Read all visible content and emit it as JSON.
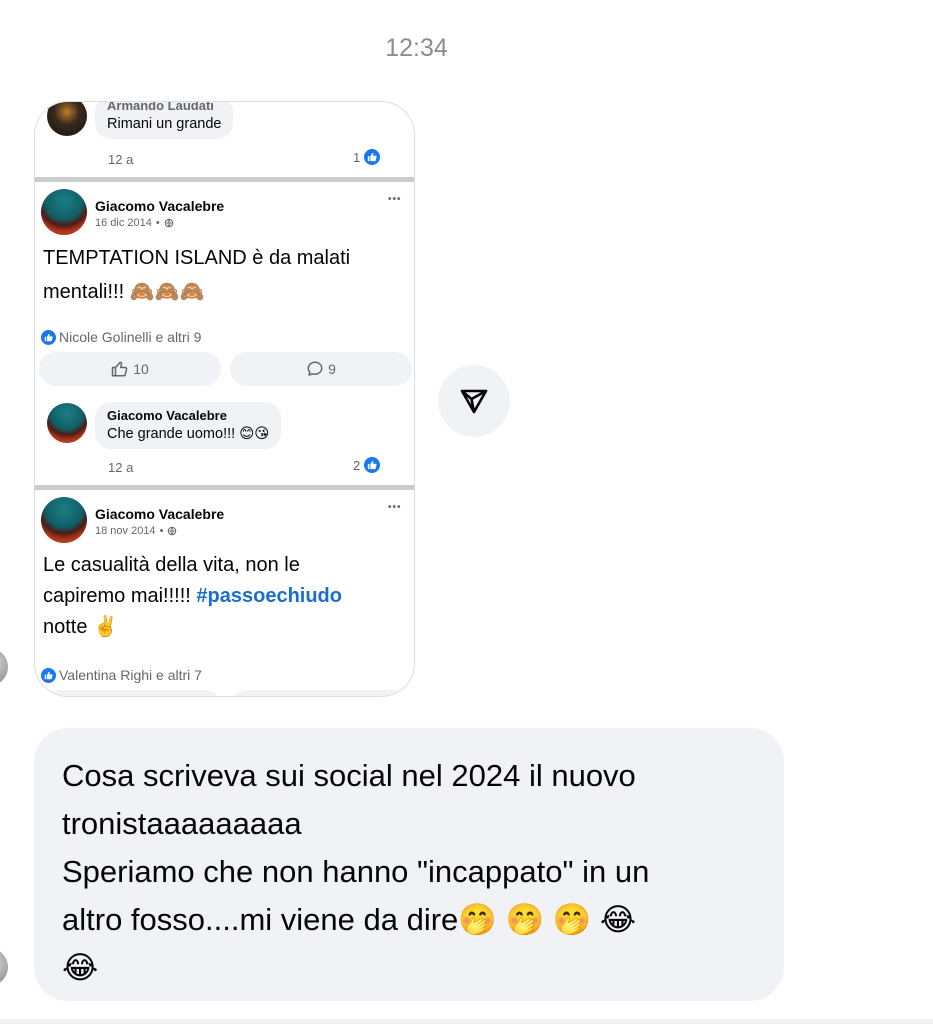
{
  "time": "12:34",
  "shared_post": {
    "first_comment": {
      "author": "Armando Laudati",
      "text": "Rimani un grande",
      "age": "12 a",
      "likes": "1"
    },
    "posts": [
      {
        "author": "Giacomo Vacalebre",
        "date": "16 dic 2014",
        "separator": "•",
        "more": "•••",
        "text_lines": [
          "TEMPTATION ISLAND è da malati",
          "mentali!!! 🙈🙈🙈"
        ],
        "reactions": "Nicole Golinelli e altri 9",
        "like_count": "10",
        "comment_count": "9",
        "comment": {
          "author": "Giacomo Vacalebre",
          "text": "Che grande uomo!!! 😊😘",
          "age": "12 a",
          "likes": "2"
        }
      },
      {
        "author": "Giacomo Vacalebre",
        "date": "18 nov 2014",
        "separator": "•",
        "more": "•••",
        "text_line1": "Le casualità della vita, non le",
        "text_line2_plain": "capiremo mai!!!!! ",
        "hashtag": "#passoechiudo",
        "text_line3": "notte ✌️",
        "reactions": "Valentina Righi e altri 7"
      }
    ]
  },
  "message": {
    "lines": [
      "Cosa scriveva sui social nel 2024 il nuovo",
      "tronistaaaaaaaaa",
      "Speriamo che non hanno \"incappato\" in un",
      "altro fosso....mi viene da dire🤭 🤭 🤭 😂",
      "😂"
    ]
  },
  "icons": {
    "forward": "forward-send-icon",
    "like": "thumbs-up-icon",
    "comment": "comment-bubble-icon",
    "globe": "globe-icon"
  },
  "colors": {
    "facebook_blue": "#1877f2",
    "hashtag": "#1a6fce",
    "bubble_gray": "#f0f2f5",
    "meta_gray": "#65676b"
  }
}
